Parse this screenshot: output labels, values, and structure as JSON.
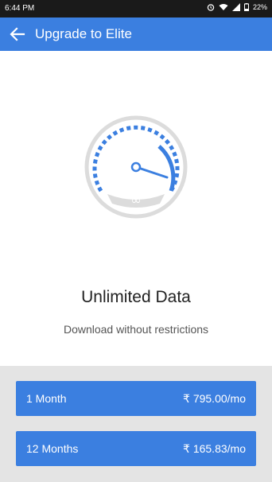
{
  "status_bar": {
    "time": "6:44 PM",
    "battery": "22%"
  },
  "app_bar": {
    "title": "Upgrade to Elite",
    "back_icon": "arrow-left-icon"
  },
  "feature": {
    "icon": "speedometer-icon",
    "infinity_symbol": "∞",
    "title": "Unlimited Data",
    "subtitle": "Download without restrictions"
  },
  "pager": {
    "count": 4,
    "active_index": 2
  },
  "plans": [
    {
      "label": "1 Month",
      "price": "₹ 795.00/mo"
    },
    {
      "label": "12 Months",
      "price": "₹ 165.83/mo"
    }
  ],
  "colors": {
    "primary": "#3b7fe0",
    "status_bar": "#1a1a1a",
    "plans_bg": "#e4e4e4"
  }
}
